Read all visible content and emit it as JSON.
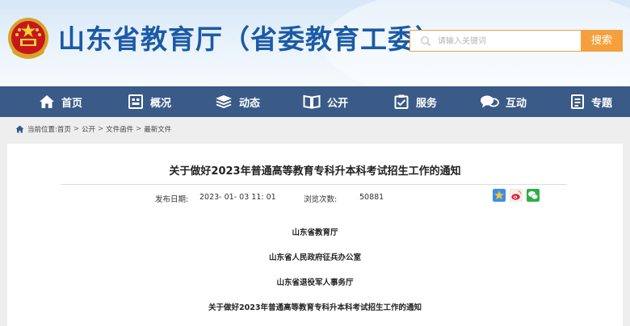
{
  "site": {
    "title": "山东省教育厅（省委教育工委）"
  },
  "search": {
    "placeholder": "请输入关键词",
    "button": "搜索"
  },
  "nav": {
    "items": [
      "首页",
      "概况",
      "动态",
      "公开",
      "服务",
      "互动",
      "专题"
    ]
  },
  "breadcrumb": {
    "prefix": "当前位置:",
    "items": [
      "首页",
      "公开",
      "文件函件",
      "最新文件"
    ],
    "separator": ">"
  },
  "article": {
    "title": "关于做好2023年普通高等教育专科升本科考试招生工作的通知",
    "publish_label": "发布日期:",
    "publish_date": "2023- 01- 03 11: 01",
    "views_label": "浏览次数:",
    "views": "50881",
    "share_icons": [
      "qzone-icon",
      "weibo-icon",
      "wechat-icon"
    ],
    "issuers": [
      "山东省教育厅",
      "山东省人民政府征兵办公室",
      "山东省退役军人事务厅"
    ],
    "body_heading": "关于做好2023年普通高等教育专科升本科考试招生工作的通知"
  },
  "colors": {
    "brand_blue": "#1b5aa6",
    "nav_bg": "#3a5a87",
    "search_orange": "#f5a03c"
  }
}
